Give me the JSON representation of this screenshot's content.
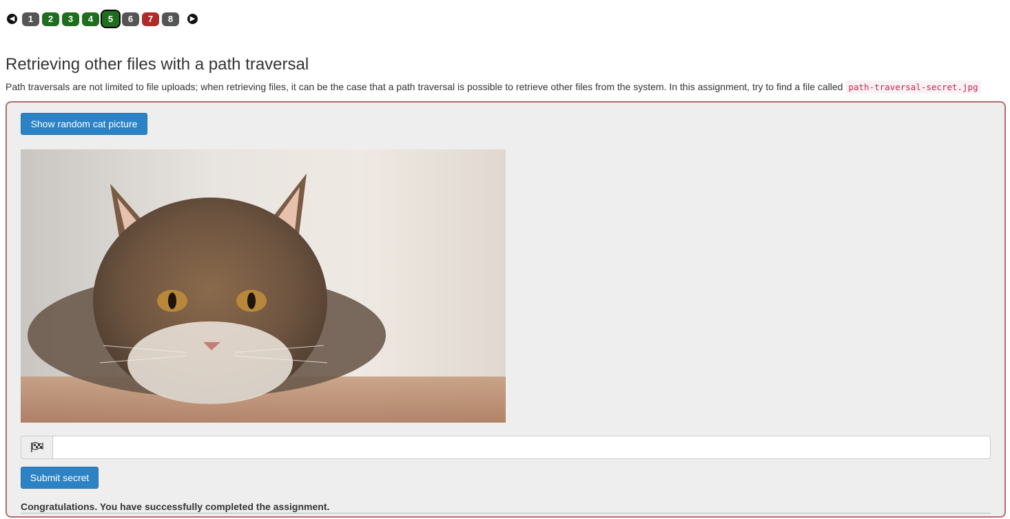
{
  "pagination": {
    "prev_icon": "arrow-left-circle-icon",
    "next_icon": "arrow-right-circle-icon",
    "pages": [
      {
        "label": "1",
        "status": "default"
      },
      {
        "label": "2",
        "status": "done"
      },
      {
        "label": "3",
        "status": "done"
      },
      {
        "label": "4",
        "status": "done"
      },
      {
        "label": "5",
        "status": "current"
      },
      {
        "label": "6",
        "status": "default"
      },
      {
        "label": "7",
        "status": "error"
      },
      {
        "label": "8",
        "status": "default"
      }
    ]
  },
  "lesson": {
    "title": "Retrieving other files with a path traversal",
    "description": "Path traversals are not limited to file uploads; when retrieving files, it can be the case that a path traversal is possible to retrieve other files from the system. In this assignment, try to find a file called",
    "filename": "path-traversal-secret.jpg"
  },
  "assignment": {
    "show_button_label": "Show random cat picture",
    "flag_icon": "flag-checkered-icon",
    "secret_input_value": "",
    "submit_button_label": "Submit secret",
    "feedback": "Congratulations. You have successfully completed the assignment."
  },
  "colors": {
    "primary": "#2b83c6",
    "done": "#1e6e1e",
    "error": "#b02a2a",
    "default": "#555555",
    "panel_border": "#b86a6a"
  }
}
